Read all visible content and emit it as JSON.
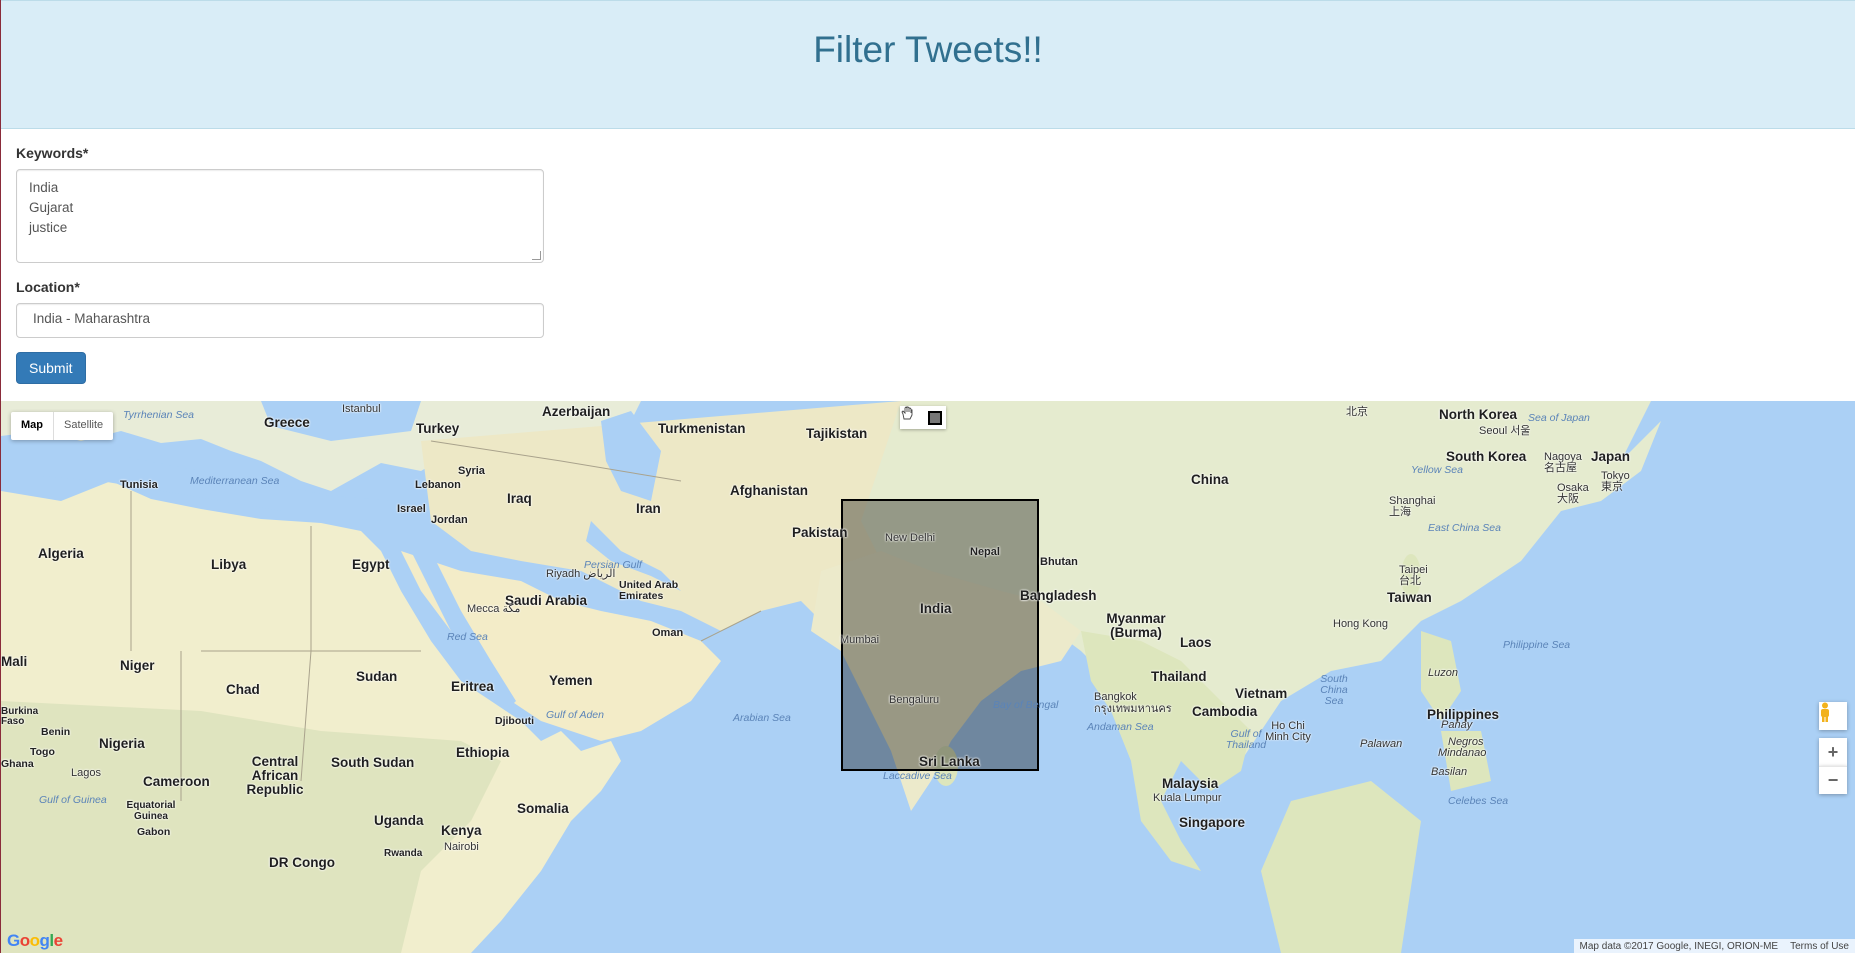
{
  "header": {
    "title": "Filter Tweets!!"
  },
  "form": {
    "keywords_label": "Keywords*",
    "keywords_lines": [
      "India",
      "Gujarat",
      "justice"
    ],
    "location_label": "Location*",
    "location_value": "India -  Maharashtra",
    "submit_label": "Submit"
  },
  "map": {
    "type_buttons": {
      "map": "Map",
      "satellite": "Satellite"
    },
    "attribution": "Map data ©2017 Google, INEGI, ORION-ME",
    "terms": "Terms of Use",
    "logo": "Google",
    "zoom_in": "+",
    "zoom_out": "−",
    "labels": {
      "greece": "Greece",
      "turkey": "Turkey",
      "azerbaijan": "Azerbaijan",
      "turkmenistan": "Turkmenistan",
      "tajikistan": "Tajikistan",
      "north_korea": "North Korea",
      "japan": "Japan",
      "south_korea": "South Korea",
      "china": "China",
      "syria": "Syria",
      "lebanon": "Lebanon",
      "iraq": "Iraq",
      "iran": "Iran",
      "afghanistan": "Afghanistan",
      "pakistan": "Pakistan",
      "israel": "Israel",
      "jordan": "Jordan",
      "algeria": "Algeria",
      "libya": "Libya",
      "egypt": "Egypt",
      "tunisia": "Tunisia",
      "saudi_arabia": "Saudi Arabia",
      "uae": "United Arab Emirates",
      "oman": "Oman",
      "yemen": "Yemen",
      "india": "India",
      "nepal": "Nepal",
      "bhutan": "Bhutan",
      "bangladesh": "Bangladesh",
      "myanmar": "Myanmar (Burma)",
      "laos": "Laos",
      "thailand": "Thailand",
      "vietnam": "Vietnam",
      "cambodia": "Cambodia",
      "taiwan": "Taiwan",
      "philippines": "Philippines",
      "malaysia": "Malaysia",
      "singapore": "Singapore",
      "sri_lanka": "Sri Lanka",
      "mali": "Mali",
      "niger": "Niger",
      "chad": "Chad",
      "sudan": "Sudan",
      "eritrea": "Eritrea",
      "ethiopia": "Ethiopia",
      "south_sudan": "South Sudan",
      "nigeria": "Nigeria",
      "car": "Central African Republic",
      "cameroon": "Cameroon",
      "somalia": "Somalia",
      "uganda": "Uganda",
      "kenya": "Kenya",
      "dr_congo": "DR Congo",
      "djibouti": "Djibouti",
      "benin": "Benin",
      "togo": "Togo",
      "ghana": "Ghana",
      "burkina": "Burkina Faso",
      "gabon": "Gabon",
      "eq_guinea": "Equatorial Guinea",
      "rwanda": "Rwanda"
    },
    "cities": {
      "istanbul": "Istanbul",
      "riyadh": "Riyadh الرياض",
      "mecca": "Mecca مكة",
      "new_delhi": "New Delhi",
      "mumbai": "Mumbai",
      "bengaluru": "Bengaluru",
      "seoul": "Seoul 서울",
      "tokyo": "Tokyo 東京",
      "nagoya": "Nagoya 名古屋",
      "osaka": "Osaka 大阪",
      "beijing": "北京",
      "shanghai": "Shanghai 上海",
      "taipei": "Taipei 台北",
      "hong_kong": "Hong Kong",
      "bangkok": "Bangkok กรุงเทพมหานคร",
      "hcmc": "Ho Chi Minh City",
      "kuala_lumpur": "Kuala Lumpur",
      "lagos": "Lagos",
      "nairobi": "Nairobi",
      "luzon": "Luzon",
      "panay": "Panay",
      "negros": "Negros",
      "mindanao": "Mindanao",
      "palawan": "Palawan",
      "basilan": "Basilan"
    },
    "seas": {
      "tyrrhenian": "Tyrrhenian Sea",
      "mediterranean": "Mediterranean Sea",
      "red": "Red Sea",
      "persian_gulf": "Persian Gulf",
      "gulf_aden": "Gulf of Aden",
      "arabian": "Arabian Sea",
      "bay_bengal": "Bay of Bengal",
      "andaman": "Andaman Sea",
      "laccadive": "Laccadive Sea",
      "sea_japan": "Sea of Japan",
      "yellow": "Yellow Sea",
      "east_china": "East China Sea",
      "south_china": "South China Sea",
      "philippine": "Philippine Sea",
      "gulf_thailand": "Gulf of Thailand",
      "celebes": "Celebes Sea",
      "gulf_guinea": "Gulf of Guinea"
    }
  }
}
